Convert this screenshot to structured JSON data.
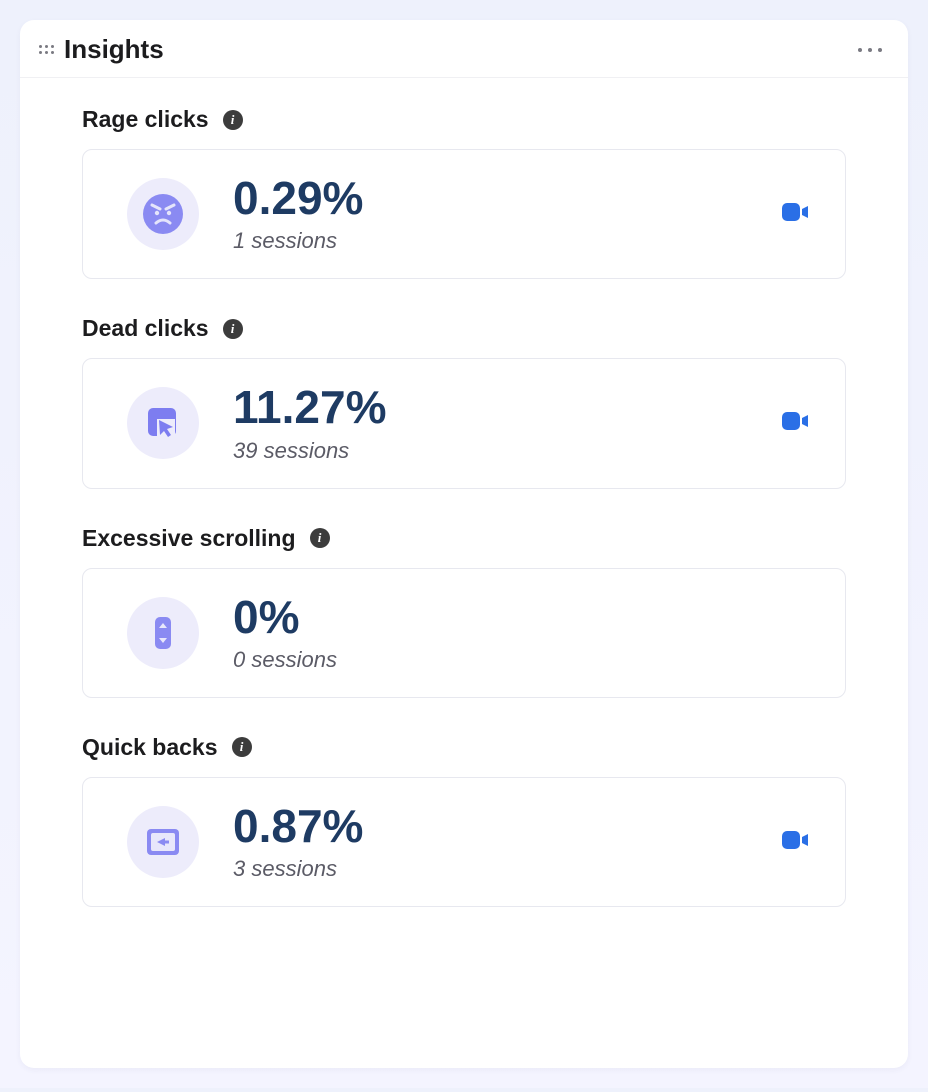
{
  "panel": {
    "title": "Insights"
  },
  "insights": [
    {
      "title": "Rage clicks",
      "value": "0.29%",
      "sessions": "1 sessions",
      "show_video": true
    },
    {
      "title": "Dead clicks",
      "value": "11.27%",
      "sessions": "39 sessions",
      "show_video": true
    },
    {
      "title": "Excessive scrolling",
      "value": "0%",
      "sessions": "0 sessions",
      "show_video": false
    },
    {
      "title": "Quick backs",
      "value": "0.87%",
      "sessions": "3 sessions",
      "show_video": true
    }
  ]
}
